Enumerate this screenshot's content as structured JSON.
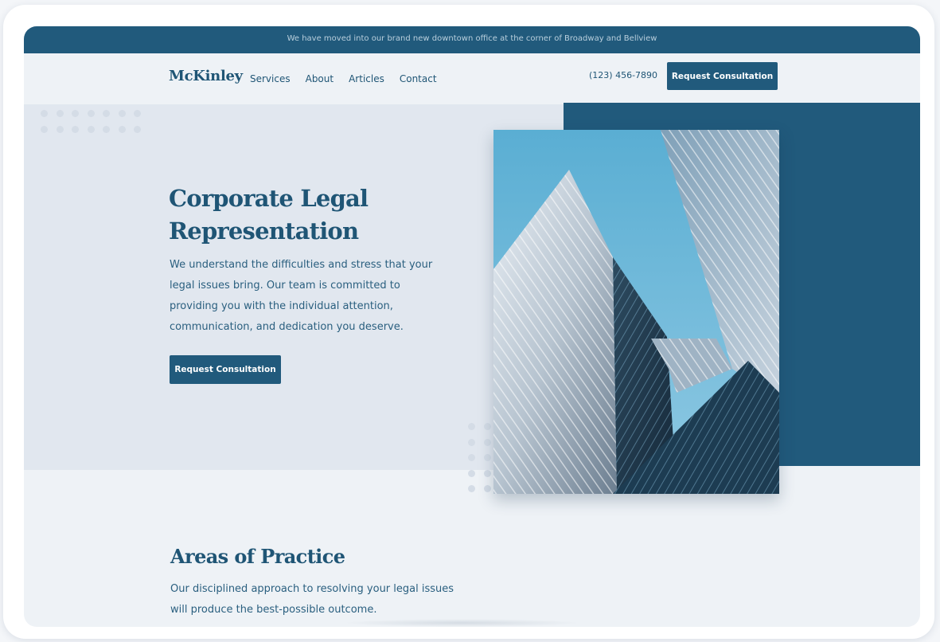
{
  "announcement": "We have moved into our brand new downtown office at the corner of Broadway and Bellview",
  "nav": {
    "logo": "McKinley",
    "links": [
      "Services",
      "About",
      "Articles",
      "Contact"
    ],
    "phone": "(123) 456-7890",
    "cta": "Request Consultation"
  },
  "hero": {
    "title": "Corporate Legal Representation",
    "text": "We understand the difficulties and stress that your legal issues bring. Our team is committed to providing you with the individual attention, communication, and dedication you deserve.",
    "cta": "Request Consultation",
    "image": "office-building-photo"
  },
  "practice": {
    "title": "Areas of Practice",
    "text": "Our disciplined approach to resolving your legal issues will produce the best-possible outcome."
  },
  "colors": {
    "primary": "#215a7c",
    "hero_background": "#e1e7ef",
    "page_background": "#eef2f6"
  }
}
